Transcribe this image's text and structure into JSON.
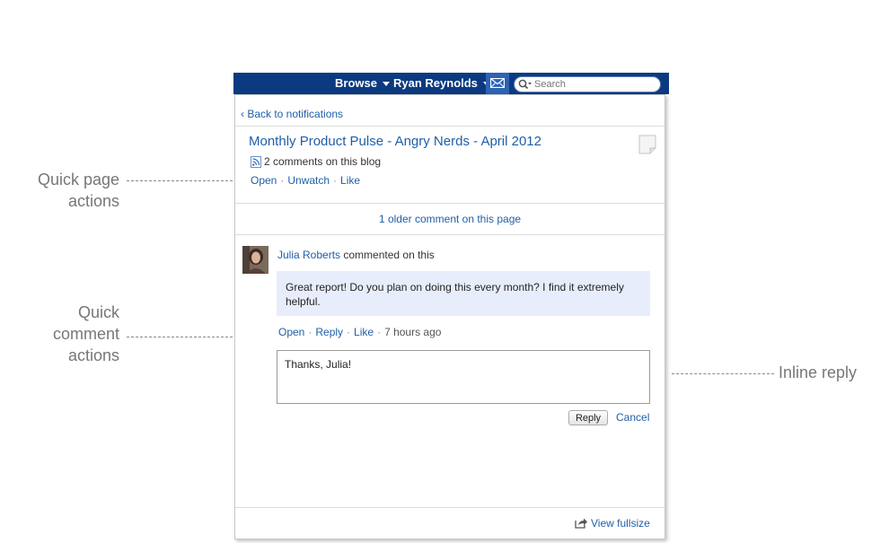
{
  "callouts": {
    "page_actions": [
      "Quick page",
      "actions"
    ],
    "comment_actions": [
      "Quick",
      "comment",
      "actions"
    ],
    "inline_reply": "Inline reply"
  },
  "topbar": {
    "browse_label": "Browse",
    "user_label": "Ryan Reynolds",
    "search_placeholder": "Search",
    "mail_icon": "envelope-icon",
    "bar_color": "#0c3a80"
  },
  "panel": {
    "back_link": "‹ Back to notifications",
    "page_title": "Monthly Product Pulse - Angry Nerds - April 2012",
    "comments_count": "2 comments on this blog",
    "page_actions": {
      "open": "Open",
      "unwatch": "Unwatch",
      "like": "Like"
    },
    "older_comments": "1 older comment on this page",
    "comment": {
      "author": "Julia Roberts",
      "verb": "commented on this",
      "text": "Great report! Do you plan on doing this every month? I find it extremely helpful.",
      "actions": {
        "open": "Open",
        "reply": "Reply",
        "like": "Like"
      },
      "time": "7 hours ago"
    },
    "reply_box_value": "Thanks, Julia!",
    "reply_button": "Reply",
    "cancel_link": "Cancel",
    "view_fullsize": "View fullsize"
  },
  "colors": {
    "link": "#1f5fa8",
    "comment_bg": "#e8edfb"
  }
}
